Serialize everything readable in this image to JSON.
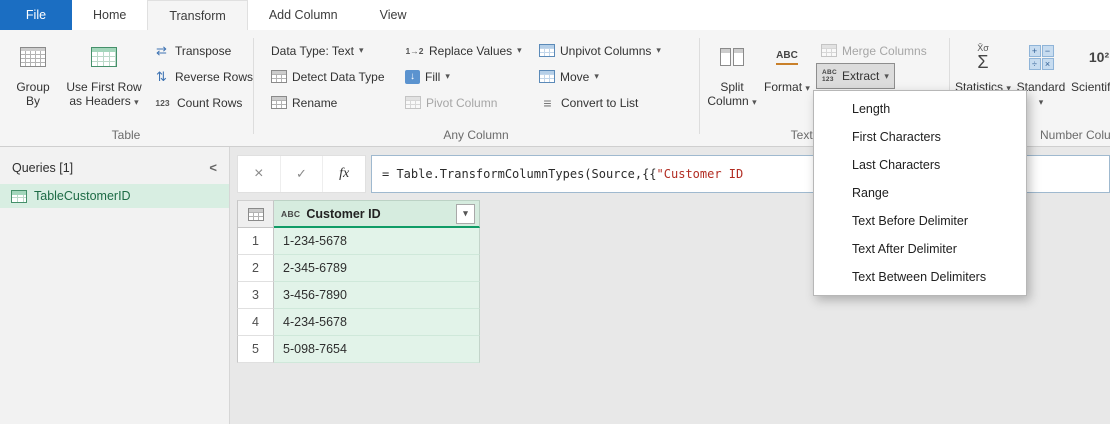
{
  "tabs": {
    "file": "File",
    "home": "Home",
    "transform": "Transform",
    "add_column": "Add Column",
    "view": "View",
    "active": "Transform"
  },
  "ribbon": {
    "table_group": {
      "label": "Table",
      "group_by": "Group By",
      "use_first_row": "Use First Row as Headers",
      "transpose": "Transpose",
      "reverse_rows": "Reverse Rows",
      "count_rows": "Count Rows"
    },
    "any_column_group": {
      "label": "Any Column",
      "data_type": "Data Type: Text",
      "detect_data_type": "Detect Data Type",
      "rename": "Rename",
      "replace_values": "Replace Values",
      "fill": "Fill",
      "pivot_column": "Pivot Column",
      "unpivot_columns": "Unpivot Columns",
      "move": "Move",
      "convert_to_list": "Convert to List"
    },
    "text_column_group": {
      "label": "Text Column",
      "split_column": "Split Column",
      "format": "Format",
      "merge_columns": "Merge Columns",
      "extract": "Extract"
    },
    "number_column_group": {
      "label": "Number Column",
      "statistics": "Statistics",
      "standard": "Standard",
      "scientific": "Scientific"
    }
  },
  "extract_menu": {
    "items": [
      "Length",
      "First Characters",
      "Last Characters",
      "Range",
      "Text Before Delimiter",
      "Text After Delimiter",
      "Text Between Delimiters"
    ]
  },
  "queries_panel": {
    "title": "Queries [1]",
    "items": [
      {
        "name": "TableCustomerID"
      }
    ]
  },
  "formula_bar": {
    "code_prefix": "= Table.TransformColumnTypes(Source,{{",
    "code_string": "\"Customer ID"
  },
  "grid": {
    "column": {
      "name": "Customer ID",
      "type": "text"
    },
    "rows": [
      {
        "num": "1",
        "value": "1-234-5678"
      },
      {
        "num": "2",
        "value": "2-345-6789"
      },
      {
        "num": "3",
        "value": "3-456-7890"
      },
      {
        "num": "4",
        "value": "4-234-5678"
      },
      {
        "num": "5",
        "value": "5-098-7654"
      }
    ]
  },
  "icons": {
    "dropdown_arrow": "▾",
    "collapse_chevron": "<",
    "cancel": "×",
    "check": "✓",
    "fx": "fx",
    "abc_type": "ABC",
    "abc": "ABC",
    "num_123": "123",
    "transpose": "⇄",
    "reverse_rows": "⇅",
    "count_rows": "123",
    "replace_values": "1→2",
    "fill_arrow": "↓",
    "convert_list": "≡",
    "stats_small": "X̄σ",
    "sigma": "Σ",
    "ten_squared": "10²",
    "op_plus": "+",
    "op_minus": "−",
    "op_div": "÷",
    "op_mul": "×"
  },
  "colors": {
    "file_tab_blue": "#1b6ec2",
    "selected_cell_green": "#e2f3e9",
    "header_underline_green": "#109c66",
    "formula_string_red": "#b22c22"
  }
}
